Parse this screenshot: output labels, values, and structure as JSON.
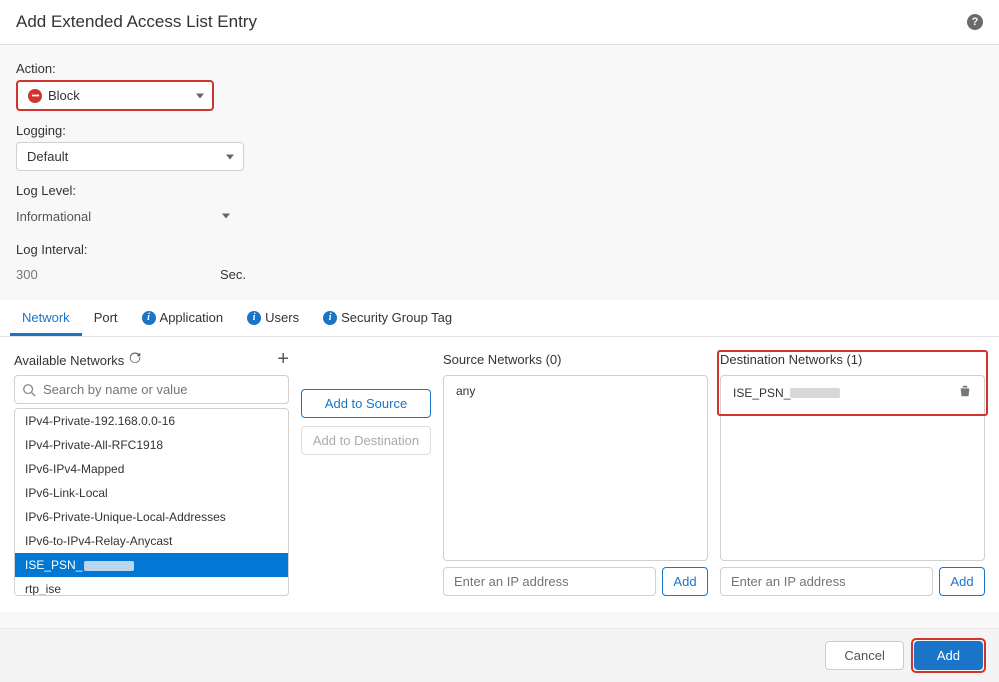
{
  "dialog": {
    "title": "Add Extended Access List Entry"
  },
  "form": {
    "action_label": "Action:",
    "action_value": "Block",
    "logging_label": "Logging:",
    "logging_value": "Default",
    "loglevel_label": "Log Level:",
    "loglevel_value": "Informational",
    "interval_label": "Log Interval:",
    "interval_value": "300",
    "interval_unit": "Sec."
  },
  "tabs": {
    "network": "Network",
    "port": "Port",
    "application": "Application",
    "users": "Users",
    "security_group_tag": "Security Group Tag"
  },
  "available": {
    "title": "Available Networks",
    "search_placeholder": "Search by name or value",
    "items": [
      "IPv4-Private-192.168.0.0-16",
      "IPv4-Private-All-RFC1918",
      "IPv6-IPv4-Mapped",
      "IPv6-Link-Local",
      "IPv6-Private-Unique-Local-Addresses",
      "IPv6-to-IPv4-Relay-Anycast",
      "ISE_PSN_",
      "rtp_ise"
    ],
    "selected_index": 6
  },
  "buttons": {
    "add_to_source": "Add to Source",
    "add_to_destination": "Add to Destination",
    "add": "Add",
    "cancel": "Cancel"
  },
  "source": {
    "title": "Source Networks (0)",
    "entries": [
      "any"
    ],
    "ip_placeholder": "Enter an IP address"
  },
  "destination": {
    "title": "Destination Networks (1)",
    "entries": [
      "ISE_PSN_"
    ],
    "ip_placeholder": "Enter an IP address"
  },
  "footer": {
    "cancel": "Cancel",
    "add": "Add"
  }
}
